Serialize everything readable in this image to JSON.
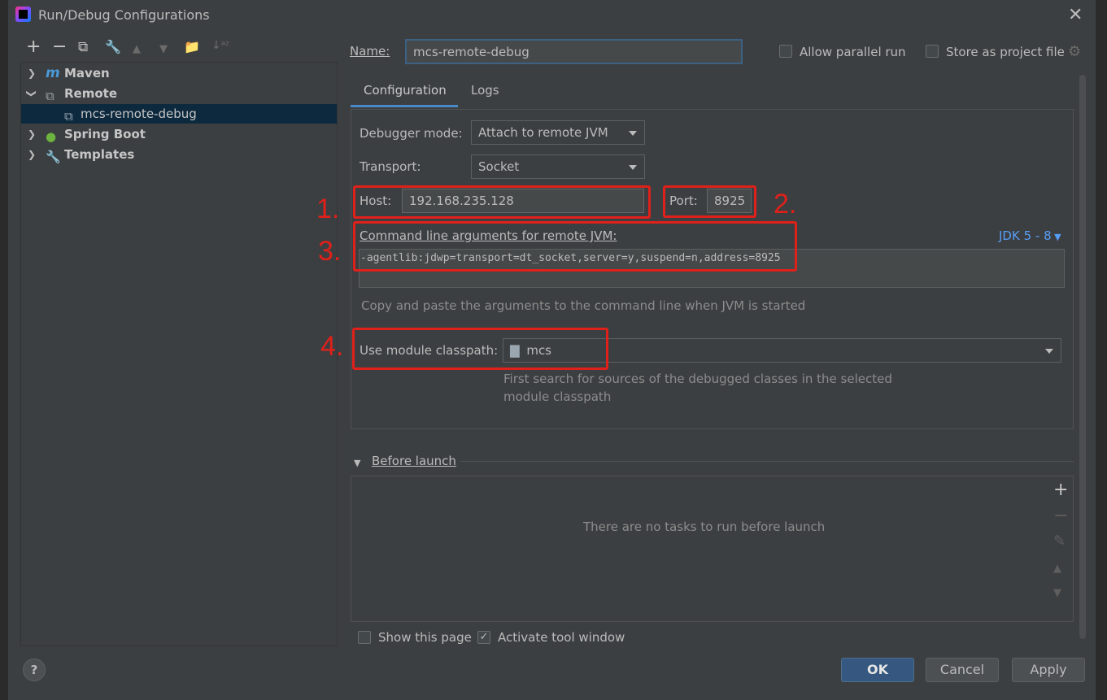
{
  "window": {
    "title": "Run/Debug Configurations"
  },
  "toolbar": {
    "add": "+",
    "remove": "−",
    "copy": "⧉",
    "edit": "🔧",
    "up": "▲",
    "down": "▼",
    "folder": "📁",
    "sort": "↓ᵃᶻ"
  },
  "tree": {
    "items": [
      {
        "label": "Maven",
        "icon": "maven-icon"
      },
      {
        "label": "Remote",
        "icon": "remote-icon"
      },
      {
        "label": "mcs-remote-debug",
        "icon": "remote-config-icon"
      },
      {
        "label": "Spring Boot",
        "icon": "spring-boot-icon"
      },
      {
        "label": "Templates",
        "icon": "wrench-icon"
      }
    ]
  },
  "header": {
    "name_label": "Name:",
    "name_value": "mcs-remote-debug",
    "allow_parallel": "Allow parallel run",
    "store_project": "Store as project file"
  },
  "tabs": [
    {
      "label": "Configuration"
    },
    {
      "label": "Logs"
    }
  ],
  "config": {
    "debugger_mode_label": "Debugger mode:",
    "debugger_mode_value": "Attach to remote JVM",
    "transport_label": "Transport:",
    "transport_value": "Socket",
    "host_label": "Host:",
    "host_value": "192.168.235.128",
    "port_label": "Port:",
    "port_value": "8925",
    "args_label": "Command line arguments for remote JVM:",
    "jdk_label": "JDK 5 - 8",
    "args_value": "-agentlib:jdwp=transport=dt_socket,server=y,suspend=n,address=8925",
    "args_hint": "Copy and paste the arguments to the command line when JVM is started",
    "classpath_label": "Use module classpath:",
    "classpath_value": "mcs",
    "classpath_hint_1": "First search for sources of the debugged classes in the selected",
    "classpath_hint_2": "module classpath"
  },
  "annotations": {
    "n1": "1.",
    "n2": "2.",
    "n3": "3.",
    "n4": "4."
  },
  "before_launch": {
    "label": "Before launch",
    "empty": "There are no tasks to run before launch"
  },
  "footer": {
    "show_page": "Show this page",
    "activate_tool": "Activate tool window",
    "ok": "OK",
    "cancel": "Cancel",
    "apply": "Apply",
    "help": "?"
  },
  "colors": {
    "accent": "#4a88c7",
    "annotation": "#e0201a",
    "selection": "#0d293e",
    "default_button": "#365880"
  }
}
